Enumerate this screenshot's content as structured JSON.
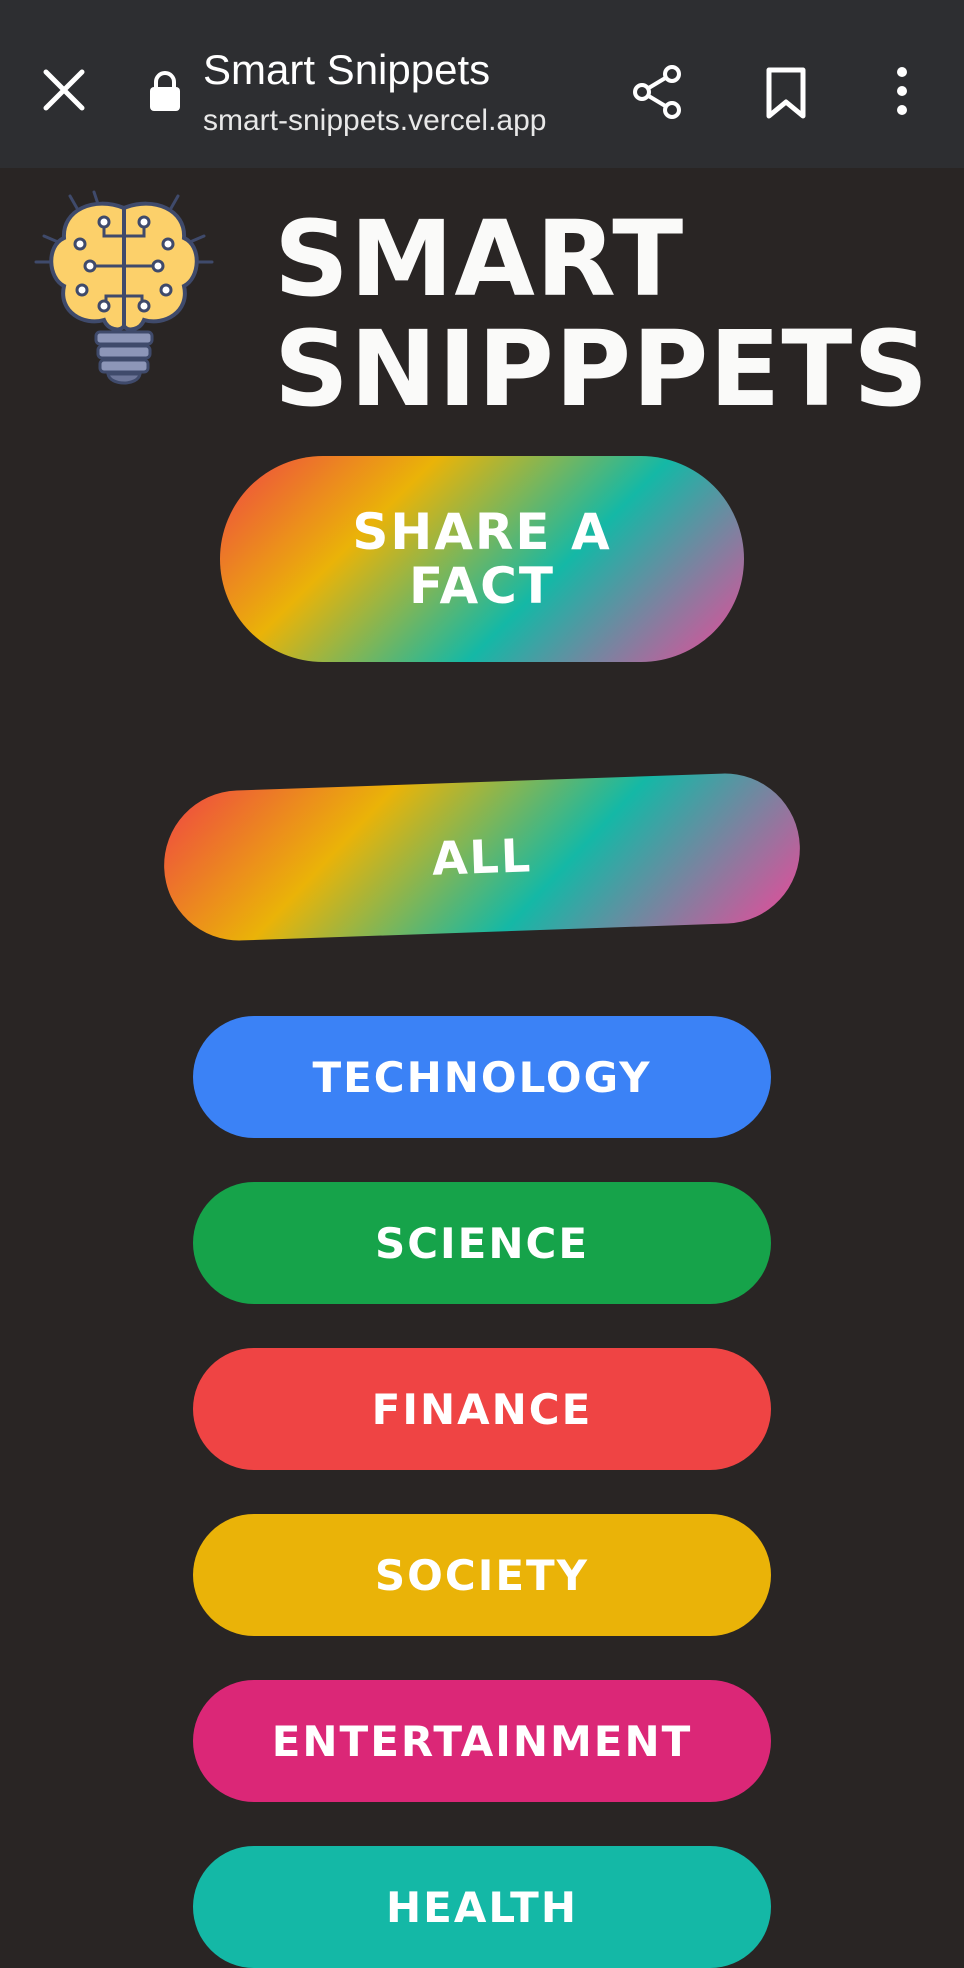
{
  "browser": {
    "title": "Smart Snippets",
    "url": "smart-snippets.vercel.app"
  },
  "header": {
    "line1": "SMART",
    "line2": "SNIPPPETS"
  },
  "actions": {
    "share_fact_line1": "SHARE A",
    "share_fact_line2": "FACT"
  },
  "categories": [
    {
      "label": "ALL",
      "color": "rainbow"
    },
    {
      "label": "TECHNOLOGY",
      "color": "#3b82f6"
    },
    {
      "label": "SCIENCE",
      "color": "#16a34a"
    },
    {
      "label": "FINANCE",
      "color": "#ef4444"
    },
    {
      "label": "SOCIETY",
      "color": "#eab308"
    },
    {
      "label": "ENTERTAINMENT",
      "color": "#db2777"
    },
    {
      "label": "HEALTH",
      "color": "#14b8a6"
    }
  ],
  "colors": {
    "background": "#292524",
    "browser_bar": "#2d2e31",
    "text": "#fafaf9"
  },
  "icons": {
    "close": "close-icon",
    "lock": "lock-icon",
    "share": "share-icon",
    "bookmark": "bookmark-icon",
    "menu": "menu-icon",
    "logo": "brain-lightbulb-logo"
  }
}
